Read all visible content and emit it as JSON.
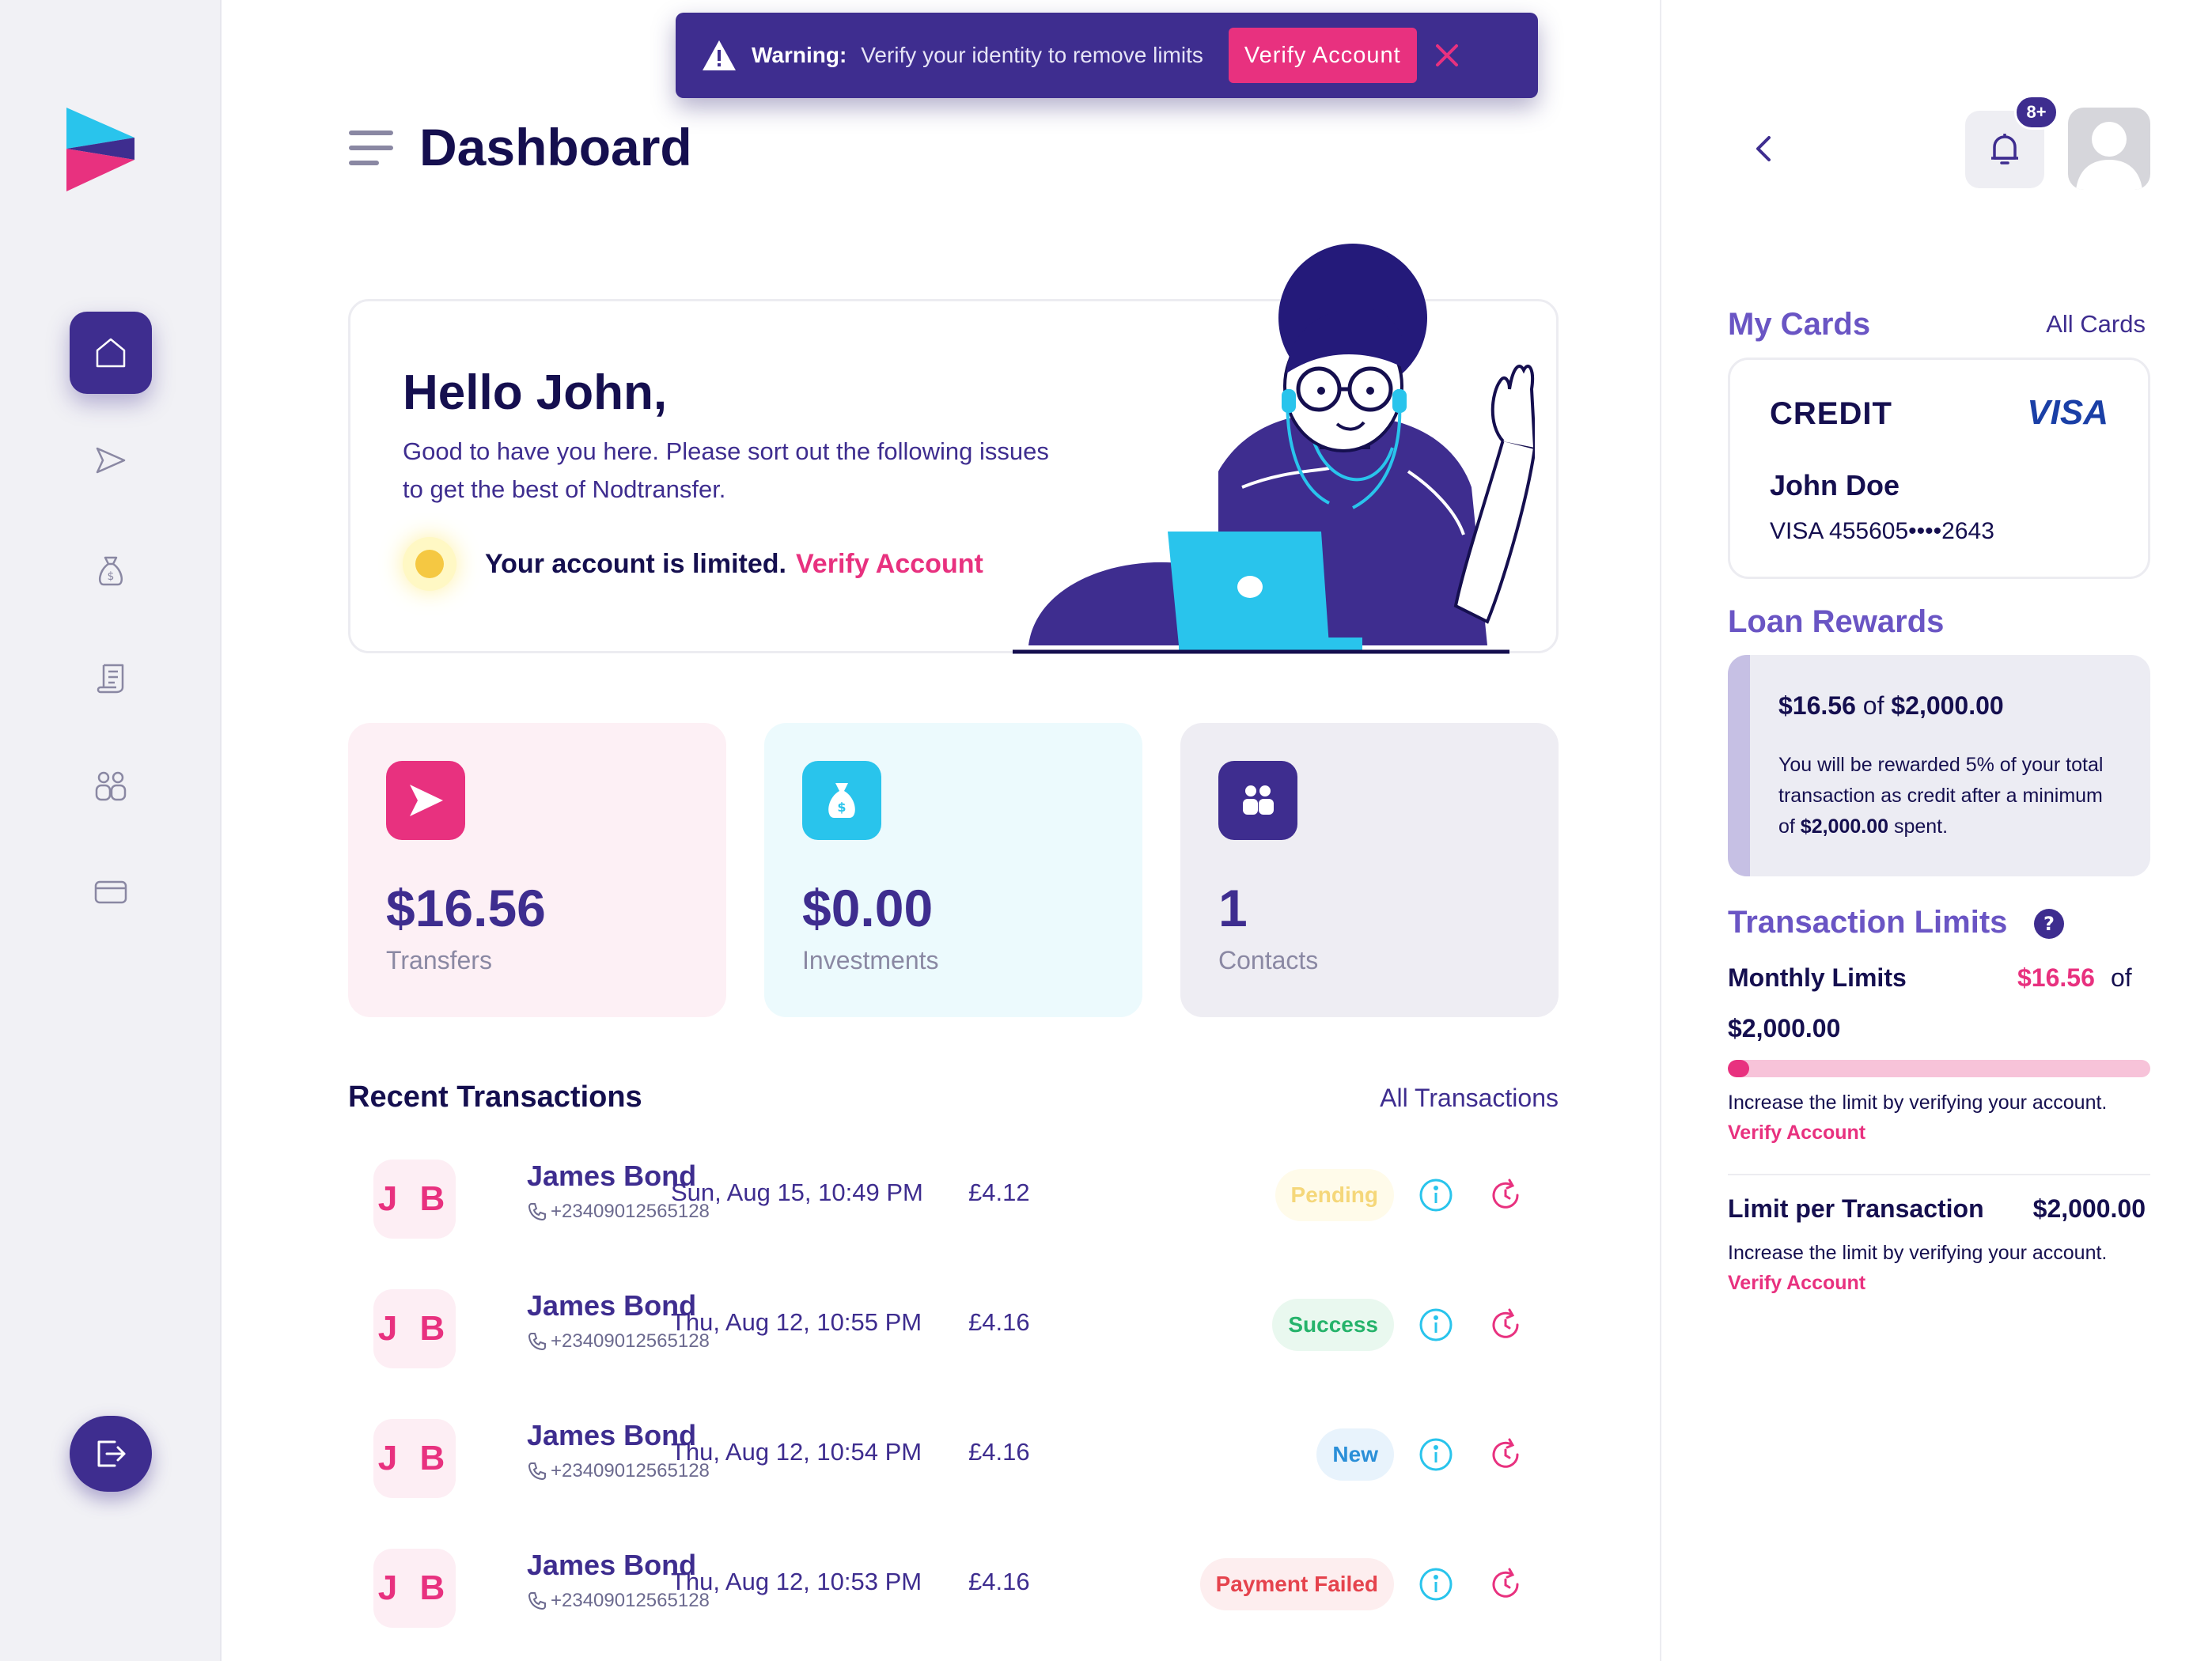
{
  "colors": {
    "primary": "#3e2d8f",
    "accent_pink": "#e8317f",
    "accent_cyan": "#29c4ec",
    "dark_text": "#150f4f",
    "success": "#26b36b",
    "pending": "#f5c842",
    "new": "#2a8fd8",
    "failed": "#e5434d"
  },
  "sidebar": {
    "items": [
      {
        "icon": "home-icon",
        "active": true
      },
      {
        "icon": "send-icon",
        "active": false
      },
      {
        "icon": "money-bag-icon",
        "active": false
      },
      {
        "icon": "receipt-icon",
        "active": false
      },
      {
        "icon": "contacts-icon",
        "active": false
      },
      {
        "icon": "card-icon",
        "active": false
      }
    ],
    "logout_icon": "logout-icon"
  },
  "banner": {
    "label": "Warning:",
    "text": "Verify your identity to remove limits",
    "button": "Verify Account"
  },
  "header": {
    "title": "Dashboard"
  },
  "hello": {
    "title": "Hello John,",
    "subtitle": "Good to have you here. Please sort out the following issues to get the best of Nodtransfer.",
    "limited_text": "Your account is limited.",
    "limited_link": "Verify Account"
  },
  "stats": [
    {
      "value": "$16.56",
      "label": "Transfers",
      "icon": "send-icon"
    },
    {
      "value": "$0.00",
      "label": "Investments",
      "icon": "money-bag-icon"
    },
    {
      "value": "1",
      "label": "Contacts",
      "icon": "contacts-icon"
    }
  ],
  "transactions": {
    "title": "Recent Transactions",
    "all_link": "All Transactions",
    "rows": [
      {
        "initials": "J B",
        "name": "James Bond",
        "phone": "+23409012565128",
        "date": "Sun, Aug 15, 10:49 PM",
        "amount": "£4.12",
        "status": "Pending"
      },
      {
        "initials": "J B",
        "name": "James Bond",
        "phone": "+23409012565128",
        "date": "Thu, Aug 12, 10:55 PM",
        "amount": "£4.16",
        "status": "Success"
      },
      {
        "initials": "J B",
        "name": "James Bond",
        "phone": "+23409012565128",
        "date": "Thu, Aug 12, 10:54 PM",
        "amount": "£4.16",
        "status": "New"
      },
      {
        "initials": "J B",
        "name": "James Bond",
        "phone": "+23409012565128",
        "date": "Thu, Aug 12, 10:53 PM",
        "amount": "£4.16",
        "status": "Payment Failed"
      }
    ]
  },
  "topbar": {
    "notification_count": "8+"
  },
  "cards": {
    "title": "My Cards",
    "all_link": "All Cards",
    "card": {
      "type": "CREDIT",
      "brand": "VISA",
      "holder": "John Doe",
      "number": "VISA  455605••••2643"
    }
  },
  "loan": {
    "title": "Loan Rewards",
    "current": "$16.56",
    "of_text": " of ",
    "target": "$2,000.00",
    "desc_pre": "You will be rewarded 5% of your total transaction as credit after a minimum of ",
    "desc_amount": "$2,000.00",
    "desc_post": " spent."
  },
  "limits": {
    "title": "Transaction Limits",
    "monthly_label": "Monthly Limits",
    "monthly_used": "$16.56",
    "monthly_of": "of",
    "monthly_total": "$2,000.00",
    "monthly_progress": 0.0083,
    "note": "Increase the limit by verifying your account.",
    "note_link": "Verify Account",
    "per_tx_label": "Limit per Transaction",
    "per_tx_value": "$2,000.00",
    "per_tx_note": "Increase the limit by verifying your account.",
    "per_tx_link": "Verify Account"
  }
}
